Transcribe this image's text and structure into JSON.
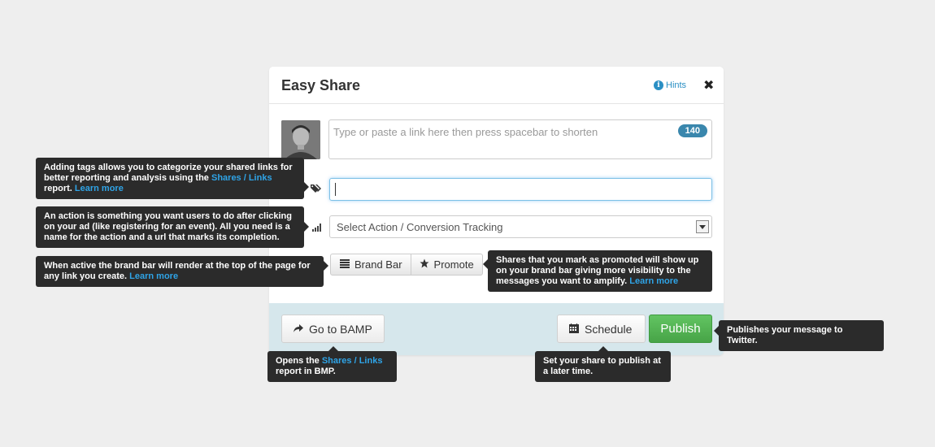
{
  "dialog": {
    "title": "Easy Share",
    "hints_label": "Hints",
    "close_glyph": "✖"
  },
  "composer": {
    "link_placeholder": "Type or paste a link here then press spacebar to shorten",
    "char_count": "140",
    "tags_value": "",
    "action_select": "Select Action / Conversion Tracking"
  },
  "toggles": {
    "brand_bar": "Brand Bar",
    "promote": "Promote"
  },
  "footer": {
    "goto": "Go to BAMP",
    "schedule": "Schedule",
    "publish": "Publish"
  },
  "tooltips": {
    "tags": {
      "text": "Adding tags allows you to categorize your shared links for better reporting and analysis using the ",
      "link": "Shares / Links",
      "text2": " report. ",
      "more": "Learn more"
    },
    "action": {
      "text": "An action is something you want users to do after clicking on your ad (like registering for an event). All you need is a name for the action and a url that marks its completion."
    },
    "brand": {
      "text": "When active the brand bar will render at the top of the page for any link you create. ",
      "more": "Learn more"
    },
    "promote": {
      "text": "Shares that you mark as promoted will show up on your brand bar giving more visibility to the messages you want to amplify. ",
      "more": "Learn more"
    },
    "goto": {
      "text": "Opens the ",
      "link": "Shares / Links",
      "text2": " report in BMP."
    },
    "schedule": {
      "text": "Set your share to publish at a later time."
    },
    "publish": {
      "text": "Publishes your message to Twitter."
    }
  },
  "colors": {
    "accent": "#2a8fc4",
    "publish": "#5cb85c",
    "footer_bg": "#d6e7ec",
    "tooltip_bg": "#2b2b2b"
  },
  "icons": [
    "info-icon",
    "close-icon",
    "tag-icon",
    "signal-icon",
    "chevron-down-icon",
    "list-icon",
    "star-icon",
    "share-arrow-icon",
    "calendar-icon"
  ]
}
